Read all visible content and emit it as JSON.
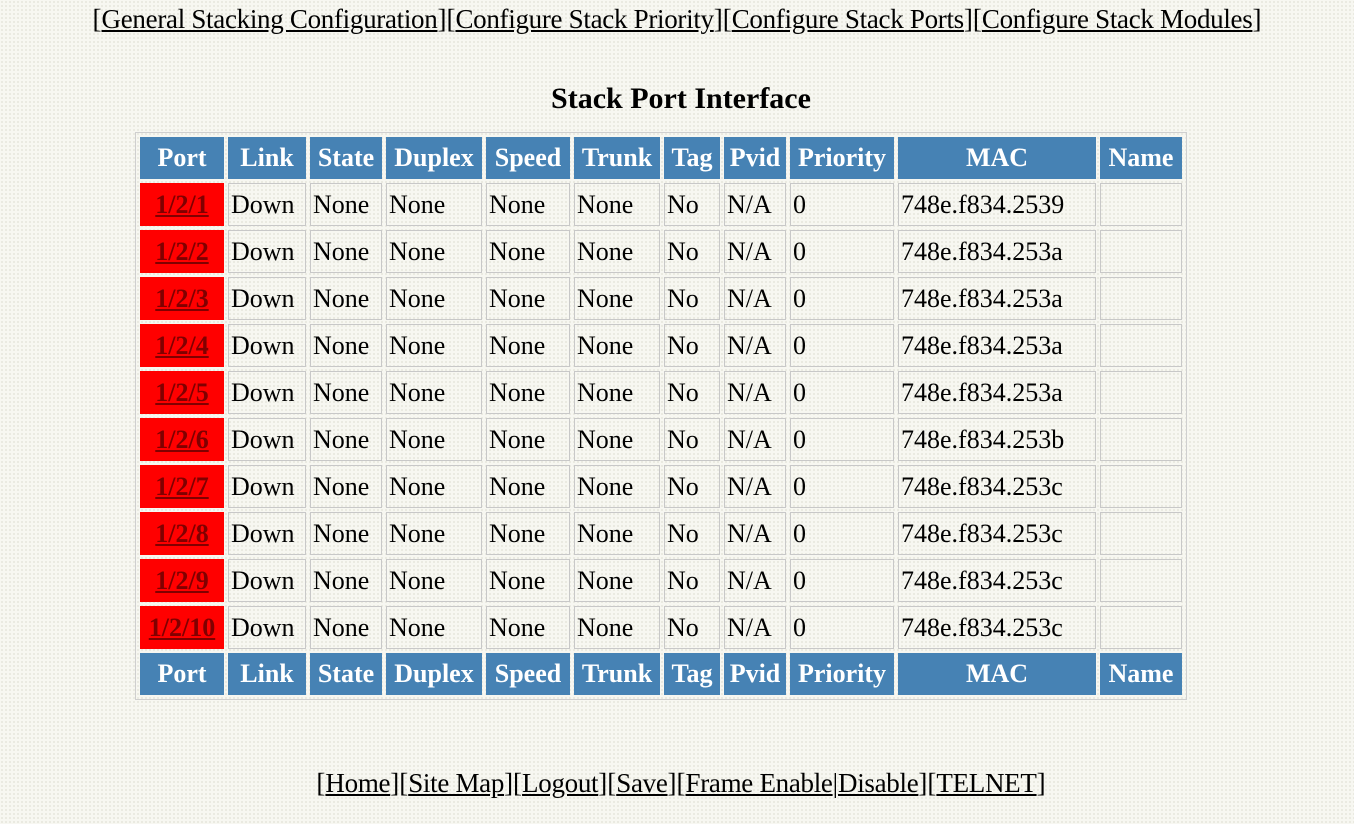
{
  "top_nav": [
    {
      "label": "General Stacking Configuration"
    },
    {
      "label": "Configure Stack Priority"
    },
    {
      "label": "Configure Stack Ports"
    },
    {
      "label": "Configure Stack Modules"
    }
  ],
  "page_title": "Stack Port Interface",
  "table": {
    "headers": [
      "Port",
      "Link",
      "State",
      "Duplex",
      "Speed",
      "Trunk",
      "Tag",
      "Pvid",
      "Priority",
      "MAC",
      "Name"
    ],
    "rows": [
      {
        "port": "1/2/1",
        "link": "Down",
        "state": "None",
        "duplex": "None",
        "speed": "None",
        "trunk": "None",
        "tag": "No",
        "pvid": "N/A",
        "priority": "0",
        "mac": "748e.f834.2539",
        "name": ""
      },
      {
        "port": "1/2/2",
        "link": "Down",
        "state": "None",
        "duplex": "None",
        "speed": "None",
        "trunk": "None",
        "tag": "No",
        "pvid": "N/A",
        "priority": "0",
        "mac": "748e.f834.253a",
        "name": ""
      },
      {
        "port": "1/2/3",
        "link": "Down",
        "state": "None",
        "duplex": "None",
        "speed": "None",
        "trunk": "None",
        "tag": "No",
        "pvid": "N/A",
        "priority": "0",
        "mac": "748e.f834.253a",
        "name": ""
      },
      {
        "port": "1/2/4",
        "link": "Down",
        "state": "None",
        "duplex": "None",
        "speed": "None",
        "trunk": "None",
        "tag": "No",
        "pvid": "N/A",
        "priority": "0",
        "mac": "748e.f834.253a",
        "name": ""
      },
      {
        "port": "1/2/5",
        "link": "Down",
        "state": "None",
        "duplex": "None",
        "speed": "None",
        "trunk": "None",
        "tag": "No",
        "pvid": "N/A",
        "priority": "0",
        "mac": "748e.f834.253a",
        "name": ""
      },
      {
        "port": "1/2/6",
        "link": "Down",
        "state": "None",
        "duplex": "None",
        "speed": "None",
        "trunk": "None",
        "tag": "No",
        "pvid": "N/A",
        "priority": "0",
        "mac": "748e.f834.253b",
        "name": ""
      },
      {
        "port": "1/2/7",
        "link": "Down",
        "state": "None",
        "duplex": "None",
        "speed": "None",
        "trunk": "None",
        "tag": "No",
        "pvid": "N/A",
        "priority": "0",
        "mac": "748e.f834.253c",
        "name": ""
      },
      {
        "port": "1/2/8",
        "link": "Down",
        "state": "None",
        "duplex": "None",
        "speed": "None",
        "trunk": "None",
        "tag": "No",
        "pvid": "N/A",
        "priority": "0",
        "mac": "748e.f834.253c",
        "name": ""
      },
      {
        "port": "1/2/9",
        "link": "Down",
        "state": "None",
        "duplex": "None",
        "speed": "None",
        "trunk": "None",
        "tag": "No",
        "pvid": "N/A",
        "priority": "0",
        "mac": "748e.f834.253c",
        "name": ""
      },
      {
        "port": "1/2/10",
        "link": "Down",
        "state": "None",
        "duplex": "None",
        "speed": "None",
        "trunk": "None",
        "tag": "No",
        "pvid": "N/A",
        "priority": "0",
        "mac": "748e.f834.253c",
        "name": ""
      }
    ]
  },
  "footer_nav": [
    {
      "label": "Home"
    },
    {
      "label": "Site Map"
    },
    {
      "label": "Logout"
    },
    {
      "label": "Save"
    },
    {
      "label": "Frame Enable"
    },
    {
      "label": "Disable"
    },
    {
      "label": "TELNET"
    }
  ],
  "colors": {
    "header_bg": "#4682b4",
    "port_cell_bg": "#ff0000",
    "port_link": "#800000",
    "page_bg": "#f7f7f1"
  }
}
